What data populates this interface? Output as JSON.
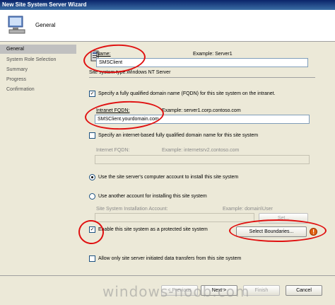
{
  "window": {
    "title": "New Site System Server Wizard"
  },
  "header": {
    "title": "General",
    "icon": "computer-icon"
  },
  "nav": {
    "items": [
      {
        "label": "General",
        "selected": true
      },
      {
        "label": "System Role Selection"
      },
      {
        "label": "Summary"
      },
      {
        "label": "Progress"
      },
      {
        "label": "Confirmation"
      }
    ]
  },
  "form": {
    "name_label": "Name:",
    "name_example": "Example: Server1",
    "name_value": "SMSClient",
    "site_system_type": "Site system type:Windows NT Server",
    "fqdn_checkbox_label": "Specify a fully qualified domain name (FQDN) for this site system on the intranet.",
    "fqdn_checkbox_checked": true,
    "intranet_fqdn_label": "Intranet FQDN:",
    "intranet_fqdn_example": "Example: server1.corp.contoso.com",
    "intranet_fqdn_value": "SMSClient.yourdomain.com",
    "internet_checkbox_label": "Specify an internet-based fully qualified domain name for this site system",
    "internet_fqdn_label": "Internet FQDN:",
    "internet_fqdn_example": "Example: internetsrv2.contoso.com",
    "radio_computer_account_label": "Use the site server's computer account to install this site system",
    "radio_other_account_label": "Use another account for installing this site system",
    "install_account_label": "Site System Installation Account:",
    "install_account_example": "Example: domain\\User",
    "set_button_label": "Set...",
    "protected_checkbox_label": "Enable this site system as a protected site system",
    "protected_checkbox_checked": true,
    "select_boundaries_label": "Select Boundaries...",
    "allow_only_label": "Allow only site server initiated data transfers from this site system"
  },
  "footer": {
    "previous_label": "< Previous",
    "next_label": "Next >",
    "finish_label": "Finish",
    "cancel_label": "Cancel"
  },
  "watermark": "windows-noob.com",
  "colors": {
    "annotation_red": "#e01010",
    "title_blue": "#0a246a"
  }
}
